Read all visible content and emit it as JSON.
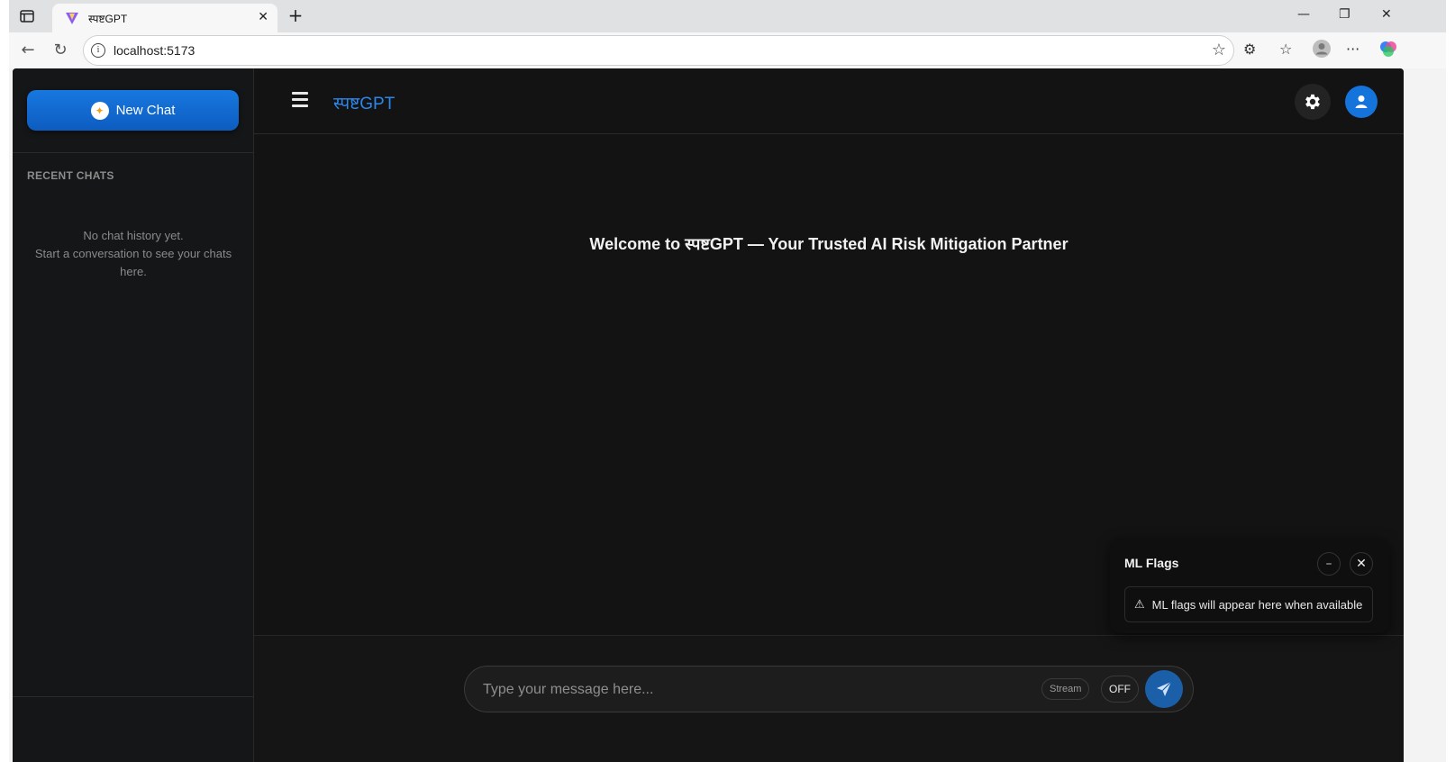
{
  "browser": {
    "tab_title": "स्पष्टGPT",
    "url": "localhost:5173",
    "new_tab_glyph": "+",
    "tab_close_glyph": "✕",
    "win_minimize": "—",
    "win_restore": "❐",
    "win_close": "✕",
    "more_glyph": "···"
  },
  "sidebar": {
    "new_chat_label": "New Chat",
    "recent_label": "RECENT CHATS",
    "empty_line1": "No chat history yet.",
    "empty_line2": "Start a conversation to see your chats here."
  },
  "header": {
    "brand": "स्पष्टGPT"
  },
  "main": {
    "welcome": "Welcome to स्पष्टGPT — Your Trusted AI Risk Mitigation Partner"
  },
  "composer": {
    "placeholder": "Type your message here...",
    "stream_label": "Stream",
    "toggle_label": "OFF"
  },
  "ml_flags": {
    "title": "ML Flags",
    "minimize_glyph": "–",
    "close_glyph": "✕",
    "warning_glyph": "⚠",
    "message": "ML flags will appear here when available"
  },
  "colors": {
    "accent": "#1574dc",
    "brand_text": "#2e86e8",
    "background": "#131313"
  }
}
